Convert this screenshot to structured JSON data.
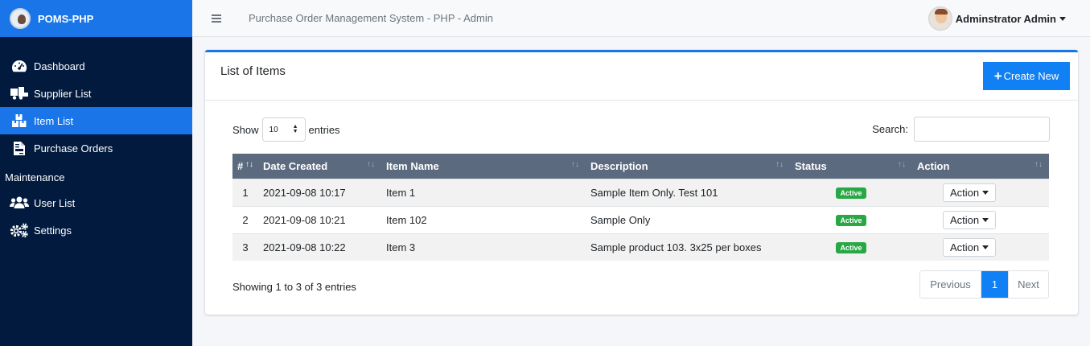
{
  "brand": {
    "name": "POMS-PHP"
  },
  "sidebar": {
    "items": [
      {
        "label": "Dashboard",
        "icon": "dashboard-icon"
      },
      {
        "label": "Supplier List",
        "icon": "truck-icon"
      },
      {
        "label": "Item List",
        "icon": "boxes-icon",
        "active": true
      },
      {
        "label": "Purchase Orders",
        "icon": "file-invoice-icon"
      }
    ],
    "section_header": "Maintenance",
    "maintenance_items": [
      {
        "label": "User List",
        "icon": "users-icon"
      },
      {
        "label": "Settings",
        "icon": "cogs-icon"
      }
    ]
  },
  "topbar": {
    "title": "Purchase Order Management System - PHP - Admin",
    "user_name": "Adminstrator Admin"
  },
  "card": {
    "title": "List of Items",
    "create_label": "Create New"
  },
  "table_controls": {
    "show_label": "Show",
    "entries_value": "10",
    "entries_label": "entries",
    "search_label": "Search:",
    "search_value": ""
  },
  "table": {
    "headers": [
      "#",
      "Date Created",
      "Item Name",
      "Description",
      "Status",
      "Action"
    ],
    "rows": [
      {
        "num": "1",
        "date": "2021-09-08 10:17",
        "name": "Item 1",
        "description": "Sample Item Only. Test 101",
        "status": "Active",
        "action": "Action"
      },
      {
        "num": "2",
        "date": "2021-09-08 10:21",
        "name": "Item 102",
        "description": "Sample Only",
        "status": "Active",
        "action": "Action"
      },
      {
        "num": "3",
        "date": "2021-09-08 10:22",
        "name": "Item 3",
        "description": "Sample product 103. 3x25 per boxes",
        "status": "Active",
        "action": "Action"
      }
    ]
  },
  "footer": {
    "info": "Showing 1 to 3 of 3 entries",
    "prev_label": "Previous",
    "page": "1",
    "next_label": "Next"
  },
  "colors": {
    "sidebar_bg": "#011a3e",
    "accent": "#1a75e8",
    "table_header": "#5b6a7f",
    "badge_active": "#28a745"
  }
}
